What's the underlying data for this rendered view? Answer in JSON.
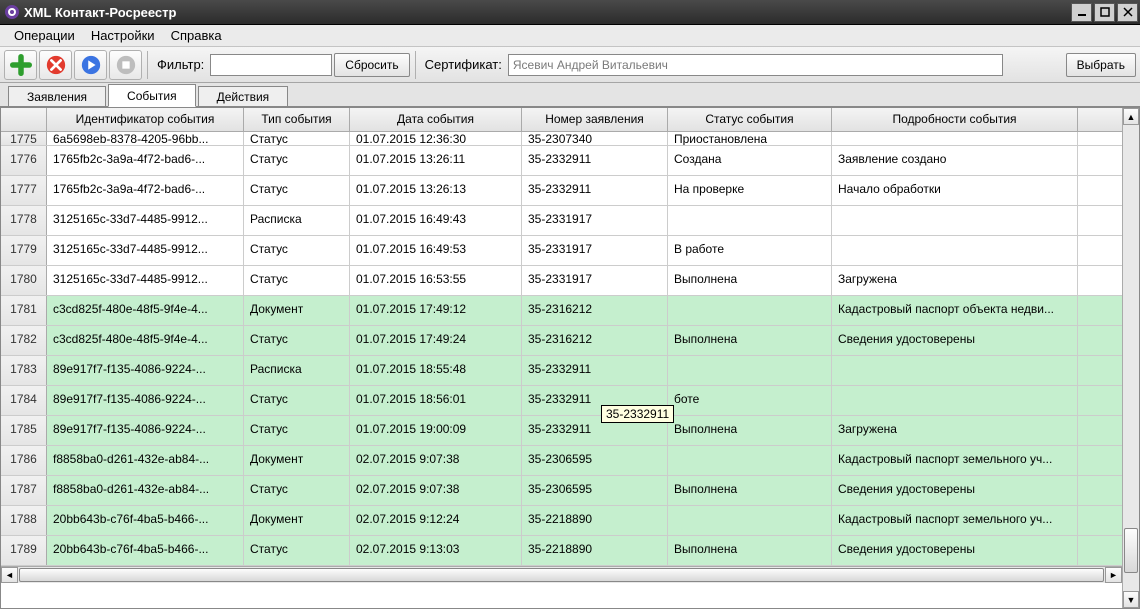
{
  "title": "XML Контакт-Росреестр",
  "menubar": {
    "operations": "Операции",
    "settings": "Настройки",
    "help": "Справка"
  },
  "toolbar": {
    "filter_label": "Фильтр:",
    "filter_value": "",
    "reset_label": "Сбросить",
    "cert_label": "Сертификат:",
    "cert_value": "Ясевич Андрей Витальевич",
    "choose_label": "Выбрать"
  },
  "tabs": {
    "applications": "Заявления",
    "events": "События",
    "actions": "Действия"
  },
  "grid": {
    "headers": {
      "rownum": "",
      "id": "Идентификатор события",
      "type": "Тип события",
      "date": "Дата события",
      "appno": "Номер заявления",
      "status": "Статус события",
      "detail": "Подробности события"
    },
    "rows": [
      {
        "n": "1775",
        "id": "6a5698eb-8378-4205-96bb...",
        "type": "Статус",
        "date": "01.07.2015 12:36:30",
        "appno": "35-2307340",
        "status": "Приостановлена",
        "detail": "",
        "green": false,
        "partial": true
      },
      {
        "n": "1776",
        "id": "1765fb2c-3a9a-4f72-bad6-...",
        "type": "Статус",
        "date": "01.07.2015 13:26:11",
        "appno": "35-2332911",
        "status": "Создана",
        "detail": "Заявление создано",
        "green": false
      },
      {
        "n": "1777",
        "id": "1765fb2c-3a9a-4f72-bad6-...",
        "type": "Статус",
        "date": "01.07.2015 13:26:13",
        "appno": "35-2332911",
        "status": "На проверке",
        "detail": "Начало обработки",
        "green": false
      },
      {
        "n": "1778",
        "id": "3125165c-33d7-4485-9912...",
        "type": "Расписка",
        "date": "01.07.2015 16:49:43",
        "appno": "35-2331917",
        "status": "",
        "detail": "",
        "green": false
      },
      {
        "n": "1779",
        "id": "3125165c-33d7-4485-9912...",
        "type": "Статус",
        "date": "01.07.2015 16:49:53",
        "appno": "35-2331917",
        "status": "В работе",
        "detail": "",
        "green": false
      },
      {
        "n": "1780",
        "id": "3125165c-33d7-4485-9912...",
        "type": "Статус",
        "date": "01.07.2015 16:53:55",
        "appno": "35-2331917",
        "status": "Выполнена",
        "detail": "Загружена",
        "green": false
      },
      {
        "n": "1781",
        "id": "c3cd825f-480e-48f5-9f4e-4...",
        "type": "Документ",
        "date": "01.07.2015 17:49:12",
        "appno": "35-2316212",
        "status": "",
        "detail": "Кадастровый паспорт объекта недви...",
        "green": true
      },
      {
        "n": "1782",
        "id": "c3cd825f-480e-48f5-9f4e-4...",
        "type": "Статус",
        "date": "01.07.2015 17:49:24",
        "appno": "35-2316212",
        "status": "Выполнена",
        "detail": "Сведения удостоверены",
        "green": true
      },
      {
        "n": "1783",
        "id": "89e917f7-f135-4086-9224-...",
        "type": "Расписка",
        "date": "01.07.2015 18:55:48",
        "appno": "35-2332911",
        "status": "",
        "detail": "",
        "green": true
      },
      {
        "n": "1784",
        "id": "89e917f7-f135-4086-9224-...",
        "type": "Статус",
        "date": "01.07.2015 18:56:01",
        "appno": "35-2332911",
        "status": "боте",
        "detail": "",
        "green": true
      },
      {
        "n": "1785",
        "id": "89e917f7-f135-4086-9224-...",
        "type": "Статус",
        "date": "01.07.2015 19:00:09",
        "appno": "35-2332911",
        "status": "Выполнена",
        "detail": "Загружена",
        "green": true
      },
      {
        "n": "1786",
        "id": "f8858ba0-d261-432e-ab84-...",
        "type": "Документ",
        "date": "02.07.2015 9:07:38",
        "appno": "35-2306595",
        "status": "",
        "detail": "Кадастровый паспорт земельного уч...",
        "green": true
      },
      {
        "n": "1787",
        "id": "f8858ba0-d261-432e-ab84-...",
        "type": "Статус",
        "date": "02.07.2015 9:07:38",
        "appno": "35-2306595",
        "status": "Выполнена",
        "detail": "Сведения удостоверены",
        "green": true
      },
      {
        "n": "1788",
        "id": "20bb643b-c76f-4ba5-b466-...",
        "type": "Документ",
        "date": "02.07.2015 9:12:24",
        "appno": "35-2218890",
        "status": "",
        "detail": "Кадастровый паспорт земельного уч...",
        "green": true
      },
      {
        "n": "1789",
        "id": "20bb643b-c76f-4ba5-b466-...",
        "type": "Статус",
        "date": "02.07.2015 9:13:03",
        "appno": "35-2218890",
        "status": "Выполнена",
        "detail": "Сведения удостоверены",
        "green": true
      }
    ]
  },
  "tooltip": {
    "text": "35-2332911"
  }
}
